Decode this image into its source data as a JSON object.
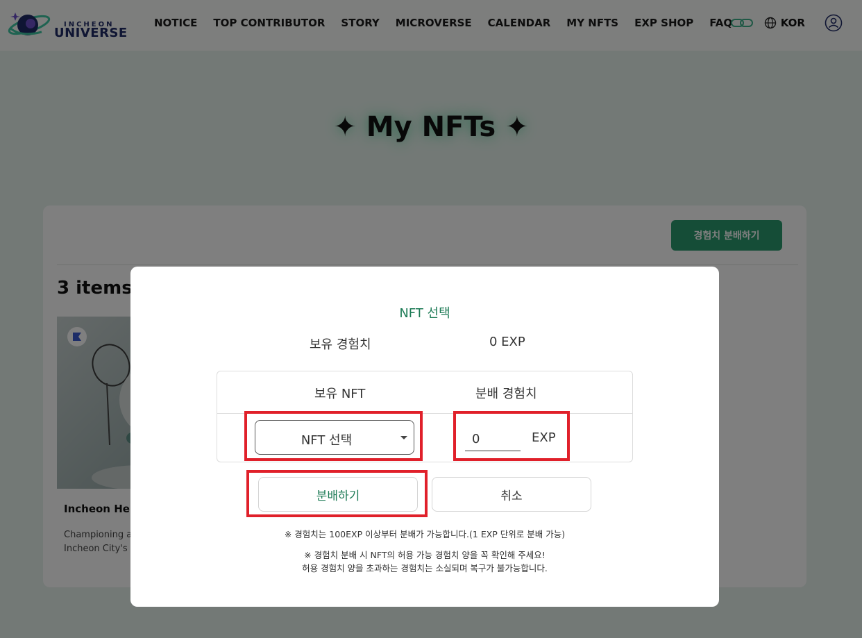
{
  "header": {
    "logo_small": "INCHEON",
    "logo_big": "UNIVERSE",
    "nav": [
      "NOTICE",
      "TOP CONTRIBUTOR",
      "STORY",
      "MICROVERSE",
      "CALENDAR",
      "MY NFTS",
      "EXP SHOP",
      "FAQ"
    ],
    "language": "KOR"
  },
  "page": {
    "title": "✦ My NFTs ✦",
    "distribute_button": "경험치 분배하기",
    "items_count": "3 items",
    "card": {
      "name": "Incheon Hero",
      "description_line1": "Championing a",
      "description_line2": "Incheon City's"
    }
  },
  "modal": {
    "title": "NFT 선택",
    "held_exp_label": "보유 경험치",
    "held_exp_value": "0 EXP",
    "col_nft": "보유 NFT",
    "col_exp": "분배 경험치",
    "select_placeholder": "NFT 선택",
    "exp_input_value": "0",
    "exp_unit": "EXP",
    "distribute_button": "분배하기",
    "cancel_button": "취소",
    "note1": "※ 경험치는 100EXP 이상부터 분배가 가능합니다.(1 EXP 단위로 분배 가능)",
    "note2": "※ 경험치 분배 시 NFT의 허용 가능 경험치 양을 꼭 확인해 주세요!",
    "note3": "허용 경험치 양을 초과하는 경험치는 소실되며 복구가 불가능합니다."
  },
  "colors": {
    "accent_green": "#2a9a6e",
    "title_green": "#1c7a55",
    "highlight_red": "#e0202a",
    "logo_navy": "#1f2a66"
  },
  "icons": [
    "logo-planet-icon",
    "chain-link-icon",
    "globe-icon",
    "user-icon",
    "chevron-down-icon"
  ]
}
